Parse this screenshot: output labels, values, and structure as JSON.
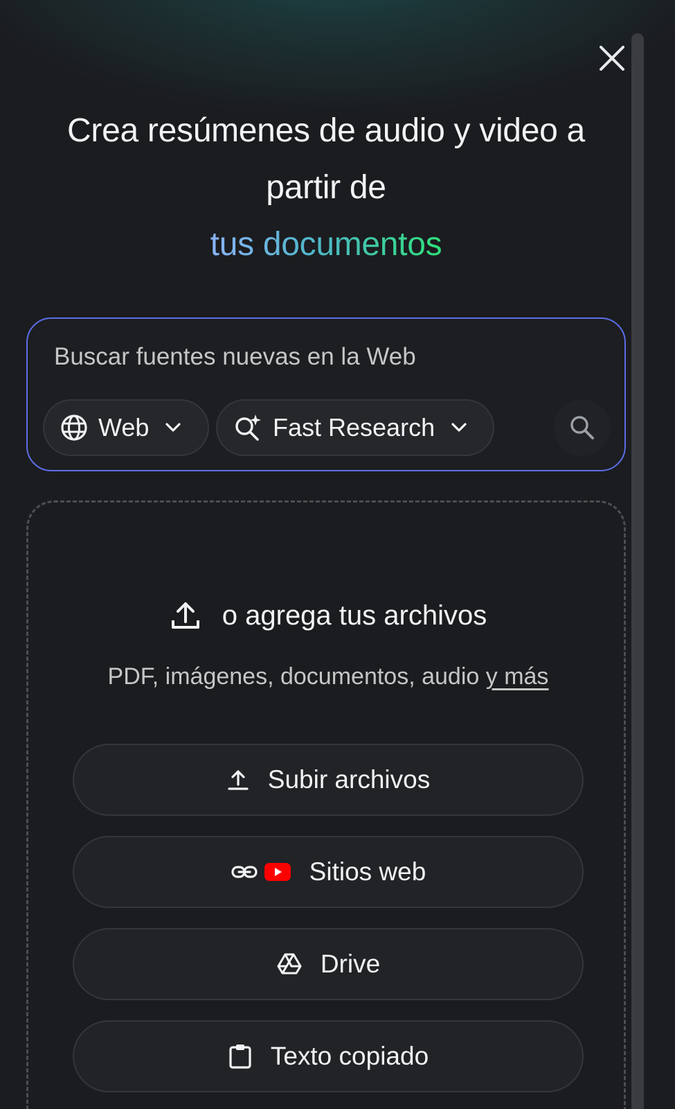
{
  "title": {
    "line1": "Crea resúmenes de audio y video a",
    "line2": "partir de",
    "line3": "tus documentos"
  },
  "search": {
    "placeholder": "Buscar fuentes nuevas en la Web",
    "source_chip": "Web",
    "mode_chip": "Fast Research"
  },
  "upload": {
    "heading": "o agrega tus archivos",
    "subtitle_prefix": "PDF, imágenes, documentos, audio ",
    "subtitle_link": "y más",
    "options": {
      "upload_files": "Subir archivos",
      "websites": "Sitios web",
      "drive": "Drive",
      "copied_text": "Texto copiado"
    }
  },
  "colors": {
    "accent_border": "#5b6ee8",
    "gradient_start": "#8ab4f8",
    "gradient_end": "#2ee07a",
    "youtube_red": "#ff0000"
  }
}
